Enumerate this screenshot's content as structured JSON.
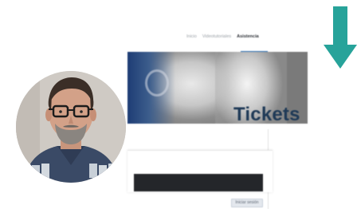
{
  "nav": {
    "items": [
      {
        "label": "Inicio",
        "active": false
      },
      {
        "label": "Videotutoriales",
        "active": false
      },
      {
        "label": "Asistencia",
        "active": true
      }
    ]
  },
  "hero": {
    "title": "Tickets"
  },
  "content": {
    "start_button": "Iniciar sesión"
  },
  "overlay": {
    "arrow_icon": "arrow-down-icon",
    "arrow_color": "#27a39a",
    "webcam": "webcam-presenter"
  },
  "colors": {
    "hero_title": "#1f3a57",
    "nav_active_underline": "#2c6fb2",
    "dark_bar": "#24262a"
  }
}
